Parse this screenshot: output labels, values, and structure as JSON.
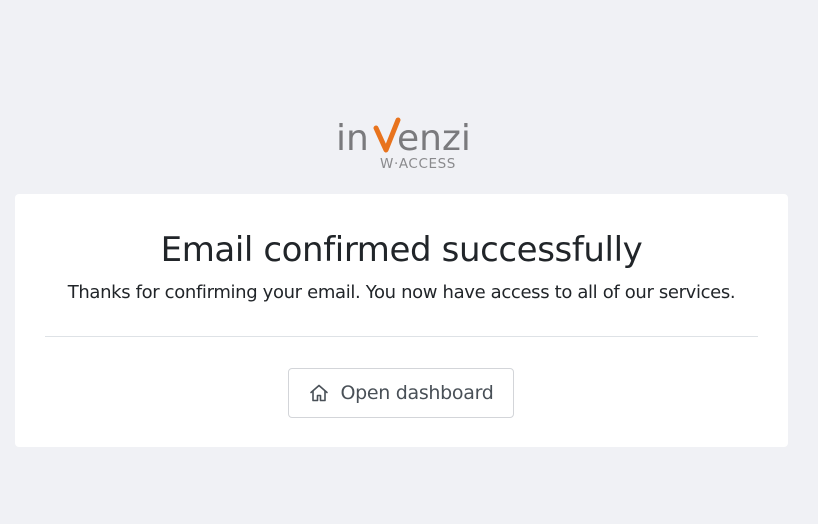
{
  "brand": {
    "name_part1": "in",
    "name_part2": "enzi",
    "product": "W·ACCESS",
    "gray": "#7a7a7d",
    "accent": "#e8731d"
  },
  "card": {
    "title": "Email confirmed successfully",
    "message": "Thanks for confirming your email. You now have access to all of our services."
  },
  "actions": {
    "dashboard_label": "Open dashboard",
    "dashboard_icon": "home-icon"
  },
  "colors": {
    "background": "#f0f1f5",
    "card": "#ffffff",
    "text": "#212529",
    "button_text": "#495057",
    "divider": "#dee2e6"
  }
}
